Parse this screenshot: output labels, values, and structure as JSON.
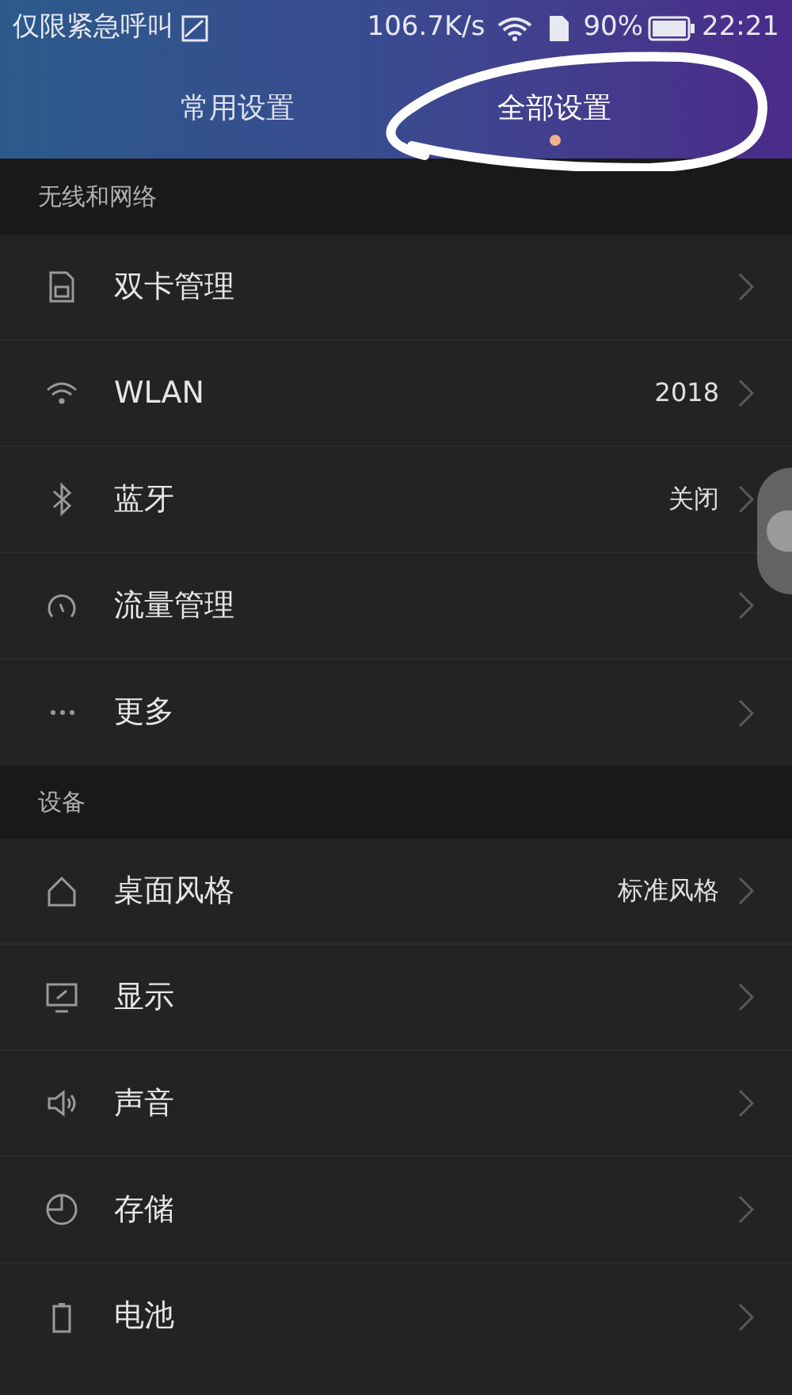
{
  "status_bar": {
    "carrier": "仅限紧急呼叫",
    "speed": "106.7K/s",
    "battery_percent": "90%",
    "time": "22:21"
  },
  "tabs": [
    {
      "label": "常用设置",
      "selected": false
    },
    {
      "label": "全部设置",
      "selected": true
    }
  ],
  "sections": [
    {
      "title": "无线和网络",
      "items": [
        {
          "label": "双卡管理"
        },
        {
          "label": "WLAN",
          "value": "2018"
        },
        {
          "label": "蓝牙",
          "value": "关闭"
        },
        {
          "label": "流量管理"
        },
        {
          "label": "更多"
        }
      ]
    },
    {
      "title": "设备",
      "items": [
        {
          "label": "桌面风格",
          "value": "标准风格"
        },
        {
          "label": "显示"
        },
        {
          "label": "声音"
        },
        {
          "label": "存储"
        },
        {
          "label": "电池"
        }
      ]
    }
  ]
}
